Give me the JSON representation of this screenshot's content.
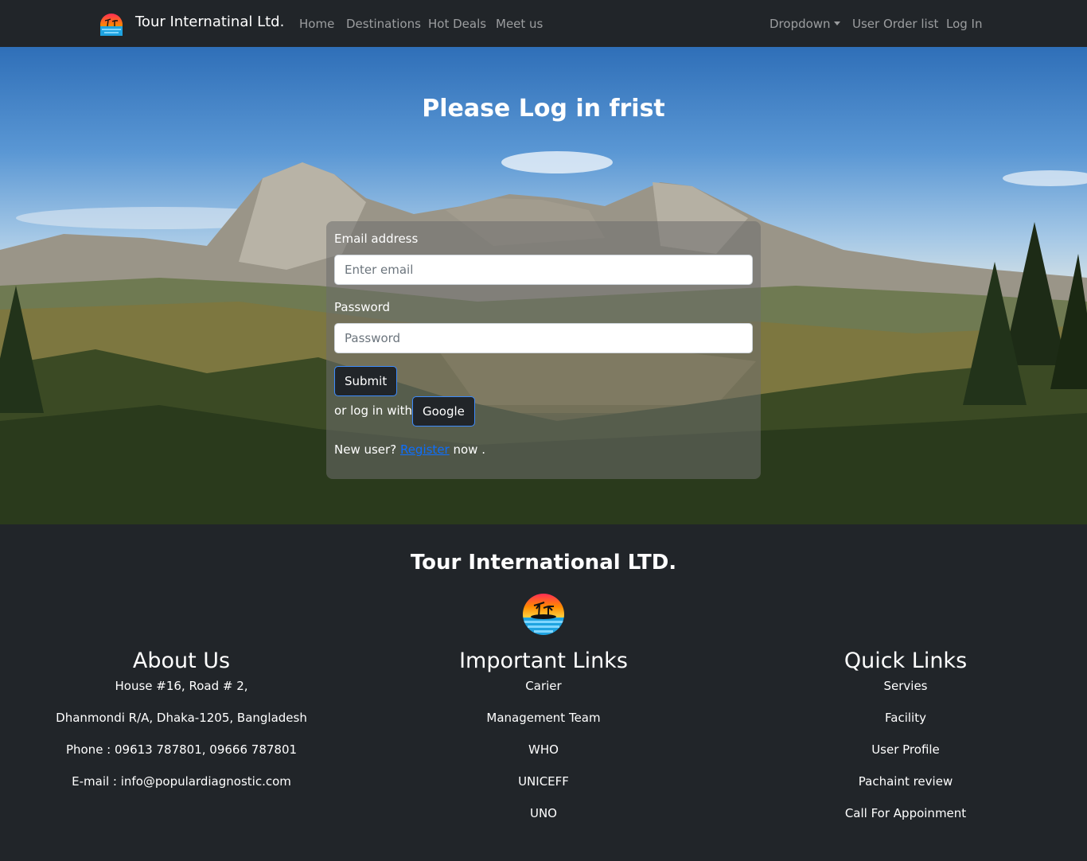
{
  "navbar": {
    "brand": "Tour Internatinal Ltd.",
    "links": [
      "Home",
      "Destinations",
      "Hot Deals",
      "Meet us"
    ],
    "right_links": {
      "dropdown": "Dropdown",
      "orders": "User Order list",
      "login": "Log In"
    }
  },
  "hero": {
    "title": "Please Log in frist"
  },
  "login_form": {
    "email_label": "Email address",
    "email_placeholder": "Enter email",
    "password_label": "Password",
    "password_placeholder": "Password",
    "submit": "Submit",
    "or_text": "or log in with",
    "google": "Google",
    "new_user": "New user?",
    "register": "Register",
    "now": "now ."
  },
  "footer": {
    "title": "Tour International LTD.",
    "about": {
      "heading": "About Us",
      "lines": [
        "House #16, Road # 2,",
        "Dhanmondi R/A, Dhaka-1205, Bangladesh",
        "Phone : 09613 787801, 09666 787801",
        "E-mail : info@populardiagnostic.com"
      ]
    },
    "important": {
      "heading": "Important Links",
      "links": [
        "Carier",
        "Management Team",
        "WHO",
        "UNICEFF",
        "UNO"
      ]
    },
    "quick": {
      "heading": "Quick Links",
      "links": [
        "Servies",
        "Facility",
        "User Profile",
        "Pachaint review",
        "Call For Appoinment"
      ]
    }
  },
  "colors": {
    "dark": "#212529",
    "link_blue": "#0d6efd",
    "nav_muted": "rgba(255,255,255,0.55)"
  },
  "icons": {
    "logo": "sunset-palm-logo",
    "caret": "caret-down-icon"
  }
}
